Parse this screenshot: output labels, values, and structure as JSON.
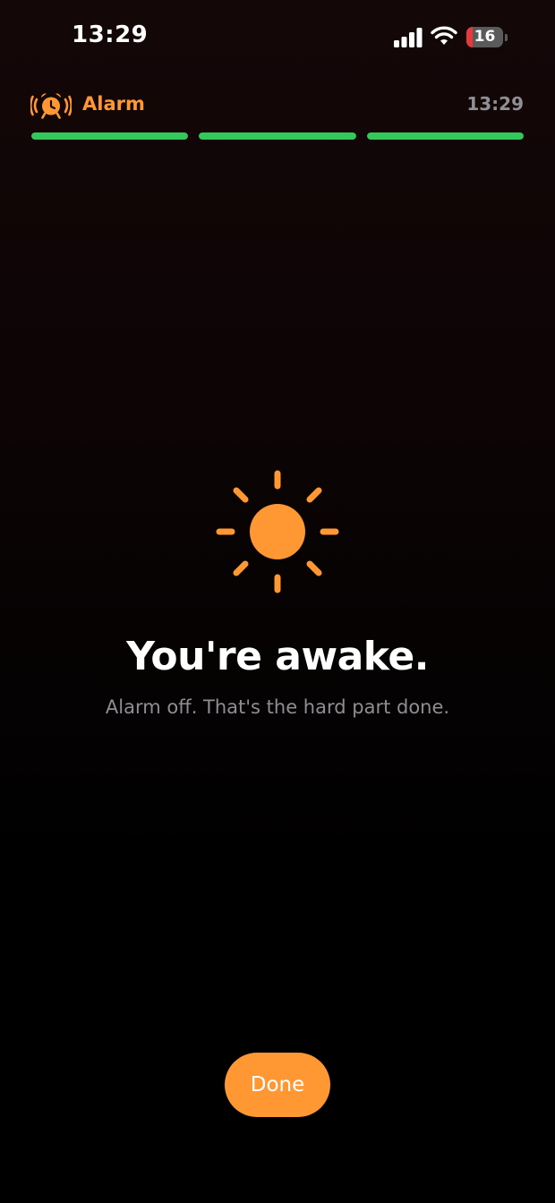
{
  "status_bar": {
    "time": "13:29",
    "battery_level": "16",
    "icons": [
      "signal-icon",
      "wifi-icon",
      "battery-icon"
    ]
  },
  "header": {
    "icon": "alarm-clock-ringing-icon",
    "title": "Alarm",
    "time": "13:29"
  },
  "progress": {
    "segments_total": 3,
    "segments_completed": 3,
    "color": "#34c759"
  },
  "main": {
    "icon": "sun-icon",
    "headline": "You're awake.",
    "subtitle": "Alarm off. That's the hard part done."
  },
  "actions": {
    "done_label": "Done"
  },
  "colors": {
    "accent": "#ff9733",
    "progress": "#34c759",
    "battery_low": "#e5393b",
    "secondary_text": "#8e8e93"
  }
}
